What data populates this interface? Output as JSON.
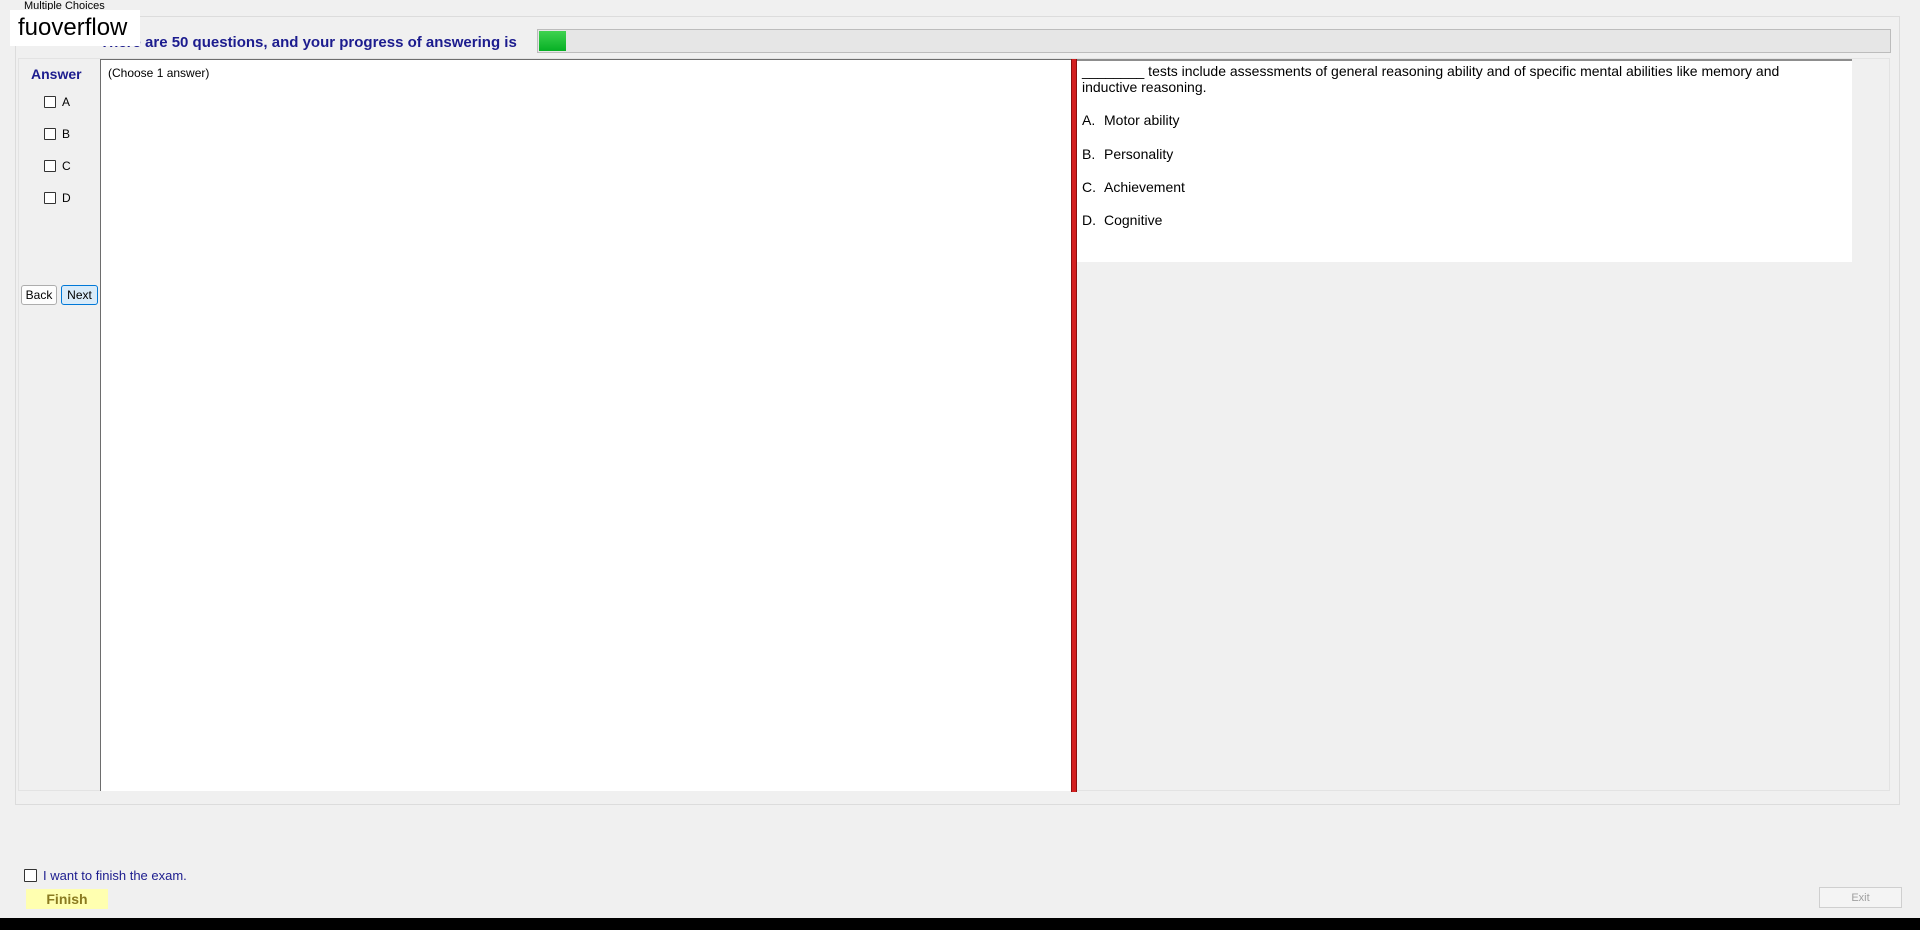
{
  "window": {
    "group_title": "Multiple Choices",
    "watermark": "fuoverflow"
  },
  "progress": {
    "label": "There are 50 questions, and your progress of answering is",
    "value_fraction": 0.02,
    "fill_color": "#06b025"
  },
  "answer_panel": {
    "title": "Answer",
    "options": [
      "A",
      "B",
      "C",
      "D"
    ],
    "back_label": "Back",
    "next_label": "Next"
  },
  "left_pane": {
    "instruction": "(Choose 1 answer)"
  },
  "question": {
    "text": "________ tests include assessments of general reasoning ability and of specific mental abilities like memory and inductive reasoning.",
    "choices": [
      {
        "letter": "A.",
        "text": "Motor ability"
      },
      {
        "letter": "B.",
        "text": "Personality"
      },
      {
        "letter": "C.",
        "text": "Achievement"
      },
      {
        "letter": "D.",
        "text": "Cognitive"
      }
    ]
  },
  "footer": {
    "finish_checkbox_label": "I want to finish the exam.",
    "finish_label": "Finish",
    "exit_label": "Exit"
  },
  "colors": {
    "accent_text": "#1c1c8e",
    "divider": "#d32020",
    "finish_bg": "#ffffb0"
  }
}
